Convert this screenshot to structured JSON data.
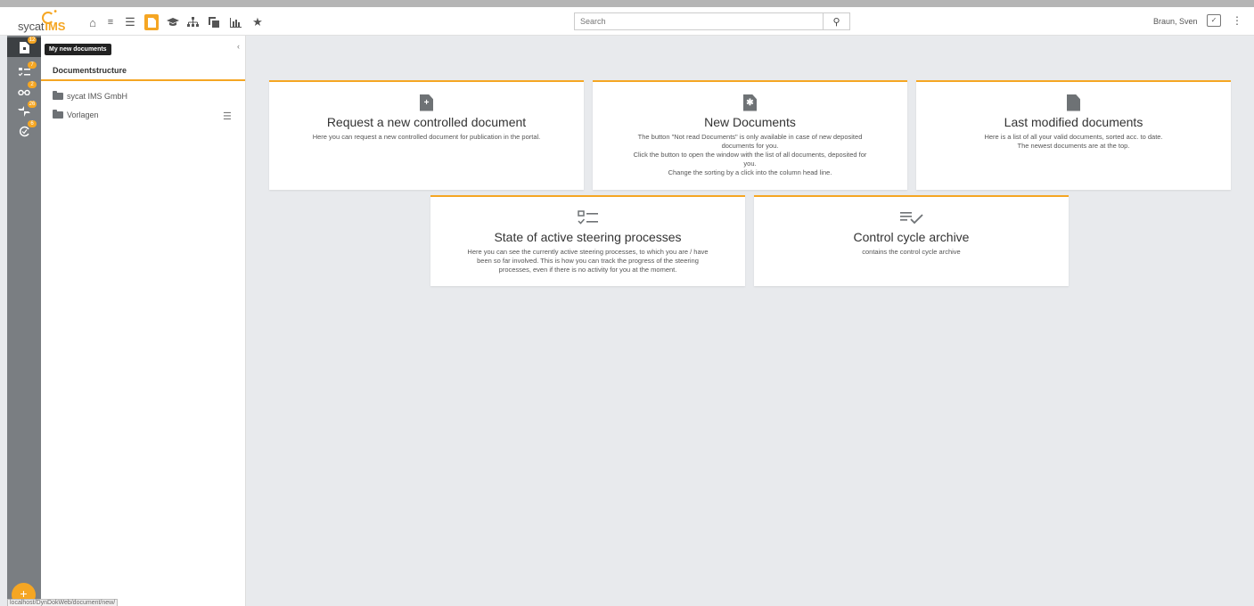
{
  "topbar": {
    "logo_text": "sycat",
    "logo_brand": "IMS",
    "search_placeholder": "Search",
    "user_name": "Braun, Sven"
  },
  "rail": {
    "items": [
      {
        "icon": "new-document-icon",
        "badge": "12"
      },
      {
        "icon": "task-list-icon",
        "badge": "7"
      },
      {
        "icon": "glasses-icon",
        "badge": "2"
      },
      {
        "icon": "feedback-icon",
        "badge": "26"
      },
      {
        "icon": "cycle-icon",
        "badge": "6"
      }
    ],
    "tooltip": "My new documents"
  },
  "tree": {
    "heading": "Documentstructure",
    "folders": [
      "sycat IMS GmbH",
      "Vorlagen"
    ]
  },
  "cards": [
    {
      "icon": "document-add-icon",
      "title": "Request a new controlled document",
      "desc": [
        "Here you can request a new controlled document for publication in the portal."
      ]
    },
    {
      "icon": "document-new-icon",
      "title": "New Documents",
      "desc": [
        "The button \"Not read Documents\" is only available in case of new deposited",
        "documents for you.",
        "Click the button to open the window with the list of all documents, deposited for",
        "you.",
        "Change the sorting by a click into the column head line."
      ]
    },
    {
      "icon": "document-icon",
      "title": "Last modified documents",
      "desc": [
        "Here is a list of all your valid documents, sorted acc. to date.",
        "The newest documents are at the top."
      ]
    },
    {
      "icon": "checklist-icon",
      "title": "State of active steering processes",
      "desc": [
        "Here you can see the currently active steering processes, to which you are / have",
        "been so far involved. This is how you can track the progress of the steering",
        "processes, even if there is no activity for you at the moment."
      ]
    },
    {
      "icon": "list-check-icon",
      "title": "Control cycle archive",
      "desc": [
        "contains the control cycle archive"
      ]
    }
  ],
  "status_url": "localhost/DynDokWeb/document/new/",
  "colors": {
    "accent": "#f5a623",
    "rail": "#7a7e82",
    "background": "#e8eaed"
  }
}
